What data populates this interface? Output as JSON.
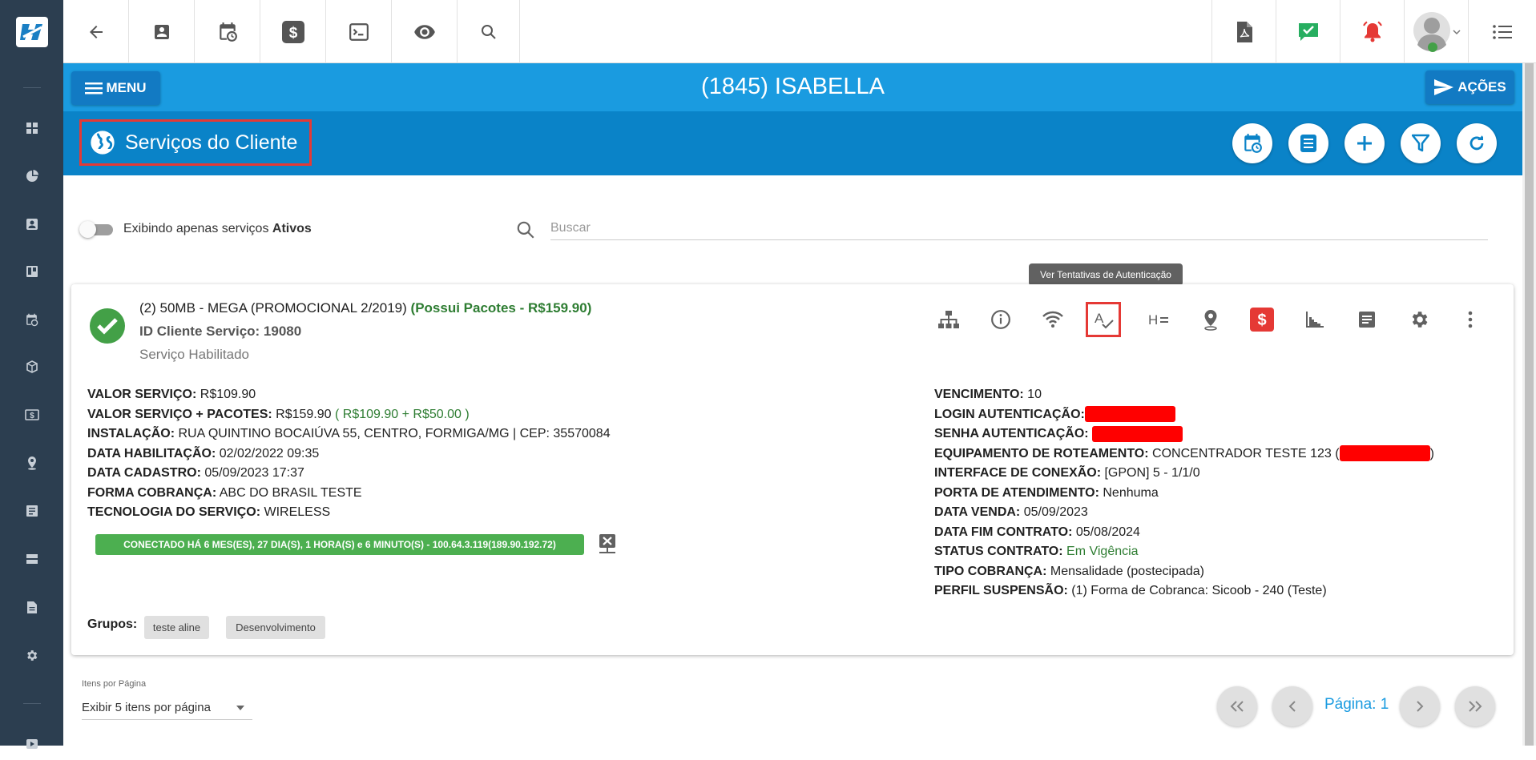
{
  "topbar": {
    "icons": [
      "back-arrow-icon",
      "contact-card-icon",
      "calendar-clock-icon",
      "dollar-icon",
      "terminal-icon",
      "eye-icon",
      "search-icon",
      "pdf-icon",
      "check-message-icon",
      "alarm-bell-icon",
      "user-avatar",
      "list-icon"
    ]
  },
  "header": {
    "menu_label": "MENU",
    "client_title": "(1845) ISABELLA",
    "actions_label": "AÇÕES"
  },
  "section": {
    "title": "Serviços do Cliente"
  },
  "filter": {
    "toggle_text": "Exibindo apenas serviços ",
    "toggle_bold": "Ativos",
    "search_placeholder": "Buscar"
  },
  "tooltip": "Ver Tentativas de Autenticação",
  "service": {
    "plan_name": "(2) 50MB - MEGA (PROMOCIONAL 2/2019)",
    "packages": "(Possui Pacotes - R$159.90)",
    "id_label": "ID Cliente Serviço: 19080",
    "status": "Serviço Habilitado",
    "left_fields": [
      {
        "label": "VALOR SERVIÇO:",
        "value": "R$109.90",
        "extra": ""
      },
      {
        "label": "VALOR SERVIÇO + PACOTES:",
        "value": "R$159.90",
        "extra": "( R$109.90 + R$50.00 )"
      },
      {
        "label": "INSTALAÇÃO:",
        "value": "RUA QUINTINO BOCAIÚVA 55, CENTRO, FORMIGA/MG | CEP: 35570084",
        "extra": ""
      },
      {
        "label": "DATA HABILITAÇÃO:",
        "value": "02/02/2022 09:35",
        "extra": ""
      },
      {
        "label": "DATA CADASTRO:",
        "value": "05/09/2023 17:37",
        "extra": ""
      },
      {
        "label": "FORMA COBRANÇA:",
        "value": "ABC DO BRASIL TESTE",
        "extra": ""
      },
      {
        "label": "TECNOLOGIA DO SERVIÇO:",
        "value": "WIRELESS",
        "extra": ""
      }
    ],
    "right_fields": [
      {
        "label": "VENCIMENTO:",
        "value": "10"
      },
      {
        "label": "LOGIN AUTENTICAÇÃO:",
        "value": ""
      },
      {
        "label": "SENHA AUTENTICAÇÃO:",
        "value": ""
      },
      {
        "label": "EQUIPAMENTO DE ROTEAMENTO:",
        "value": "CONCENTRADOR TESTE 123 ("
      },
      {
        "label": "INTERFACE DE CONEXÃO:",
        "value": "[GPON] 5 - 1/1/0"
      },
      {
        "label": "PORTA DE ATENDIMENTO:",
        "value": "Nenhuma"
      },
      {
        "label": "DATA VENDA:",
        "value": "05/09/2023"
      },
      {
        "label": "DATA FIM CONTRATO:",
        "value": "05/08/2024"
      },
      {
        "label": "STATUS CONTRATO:",
        "value": "Em Vigência"
      },
      {
        "label": "TIPO COBRANÇA:",
        "value": "Mensalidade (postecipada)"
      },
      {
        "label": "PERFIL SUSPENSÃO:",
        "value": "(1) Forma de Cobranca: Sicoob - 240 (Teste)"
      }
    ],
    "equip_close": ")",
    "connection": "CONECTADO HÁ 6 MES(ES), 27 DIA(S), 1 HORA(S) e 6 MINUTO(S) - 100.64.3.119(189.90.192.72)",
    "groups_label": "Grupos:",
    "groups": [
      "teste aline",
      "Desenvolvimento"
    ]
  },
  "pagination": {
    "items_label": "Itens por Página",
    "items_value": "Exibir 5 itens por página",
    "page_label": "Página: 1"
  },
  "colors": {
    "primary": "#1a9be0",
    "dark_blue": "#0a83c8",
    "sidebar": "#2c3e50",
    "success": "#43a047",
    "danger": "#e53935"
  }
}
